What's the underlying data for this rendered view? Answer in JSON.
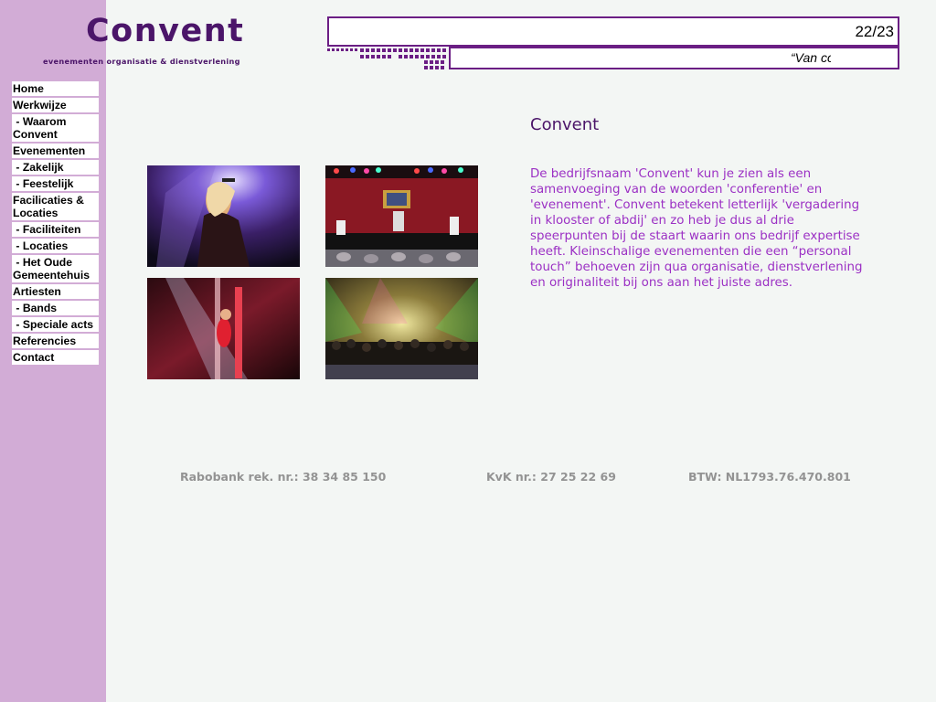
{
  "logo": {
    "word": "Convent",
    "tagline": "evenementen organisatie & dienstverlening"
  },
  "ticker": {
    "counter": "22/23",
    "quote": "“Van co"
  },
  "nav": [
    {
      "label": "Home"
    },
    {
      "label": "Werkwijze"
    },
    {
      "label": " - Waarom Convent"
    },
    {
      "label": "Evenementen"
    },
    {
      "label": " - Zakelijk"
    },
    {
      "label": " - Feestelijk"
    },
    {
      "label": "Facilicaties & Locaties"
    },
    {
      "label": " - Faciliteiten"
    },
    {
      "label": " - Locaties"
    },
    {
      "label": " - Het Oude Gemeentehuis"
    },
    {
      "label": "Artiesten"
    },
    {
      "label": " - Bands"
    },
    {
      "label": " - Speciale acts"
    },
    {
      "label": "Referencies"
    },
    {
      "label": "Contact"
    }
  ],
  "content": {
    "title": "Convent",
    "body": "De bedrijfsnaam 'Convent' kun je zien als een samenvoeging van de woorden 'conferentie' en 'evenement'. Convent betekent letterlijk 'vergadering in klooster of abdij' en zo heb je dus al drie speerpunten bij de staart waarin ons bedrijf expertise heeft. Kleinschalige evenementen die een “personal touch” behoeven zijn qua organisatie, dienstverlening en originaliteit bij ons aan het juiste adres."
  },
  "footer": {
    "bank": "Rabobank rek. nr.: 38 34 85 150",
    "kvk": "KvK nr.: 27 25 22 69",
    "btw": "BTW: NL1793.76.470.801"
  },
  "colors": {
    "sidebar": "#d2acd6",
    "brand": "#4b1569",
    "body_text": "#9b30c4",
    "footer_text": "#939393",
    "background": "#f3f6f4"
  }
}
